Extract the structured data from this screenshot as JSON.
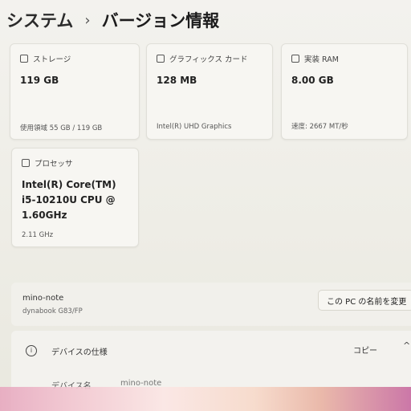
{
  "breadcrumb": {
    "root": "システム",
    "separator": "›",
    "current": "バージョン情報"
  },
  "storage": {
    "label": "ストレージ",
    "value": "119 GB",
    "detail": "使用領域 55 GB / 119 GB"
  },
  "graphics": {
    "label": "グラフィックス カード",
    "value": "128 MB",
    "detail": "Intel(R) UHD Graphics"
  },
  "ram": {
    "label": "実装 RAM",
    "value": "8.00 GB",
    "detail": "速度: 2667 MT/秒"
  },
  "processor": {
    "label": "プロセッサ",
    "value_lines": [
      "Intel(R) Core(TM)",
      "i5-10210U CPU @",
      "1.60GHz"
    ],
    "detail": "2.11 GHz"
  },
  "device": {
    "name": "mino-note",
    "model": "dynabook G83/FP",
    "rename_button": "この PC の名前を変更"
  },
  "specs": {
    "title": "デバイスの仕様",
    "copy_button": "コピー",
    "row_label": "デバイス名",
    "row_value": "mino-note"
  }
}
